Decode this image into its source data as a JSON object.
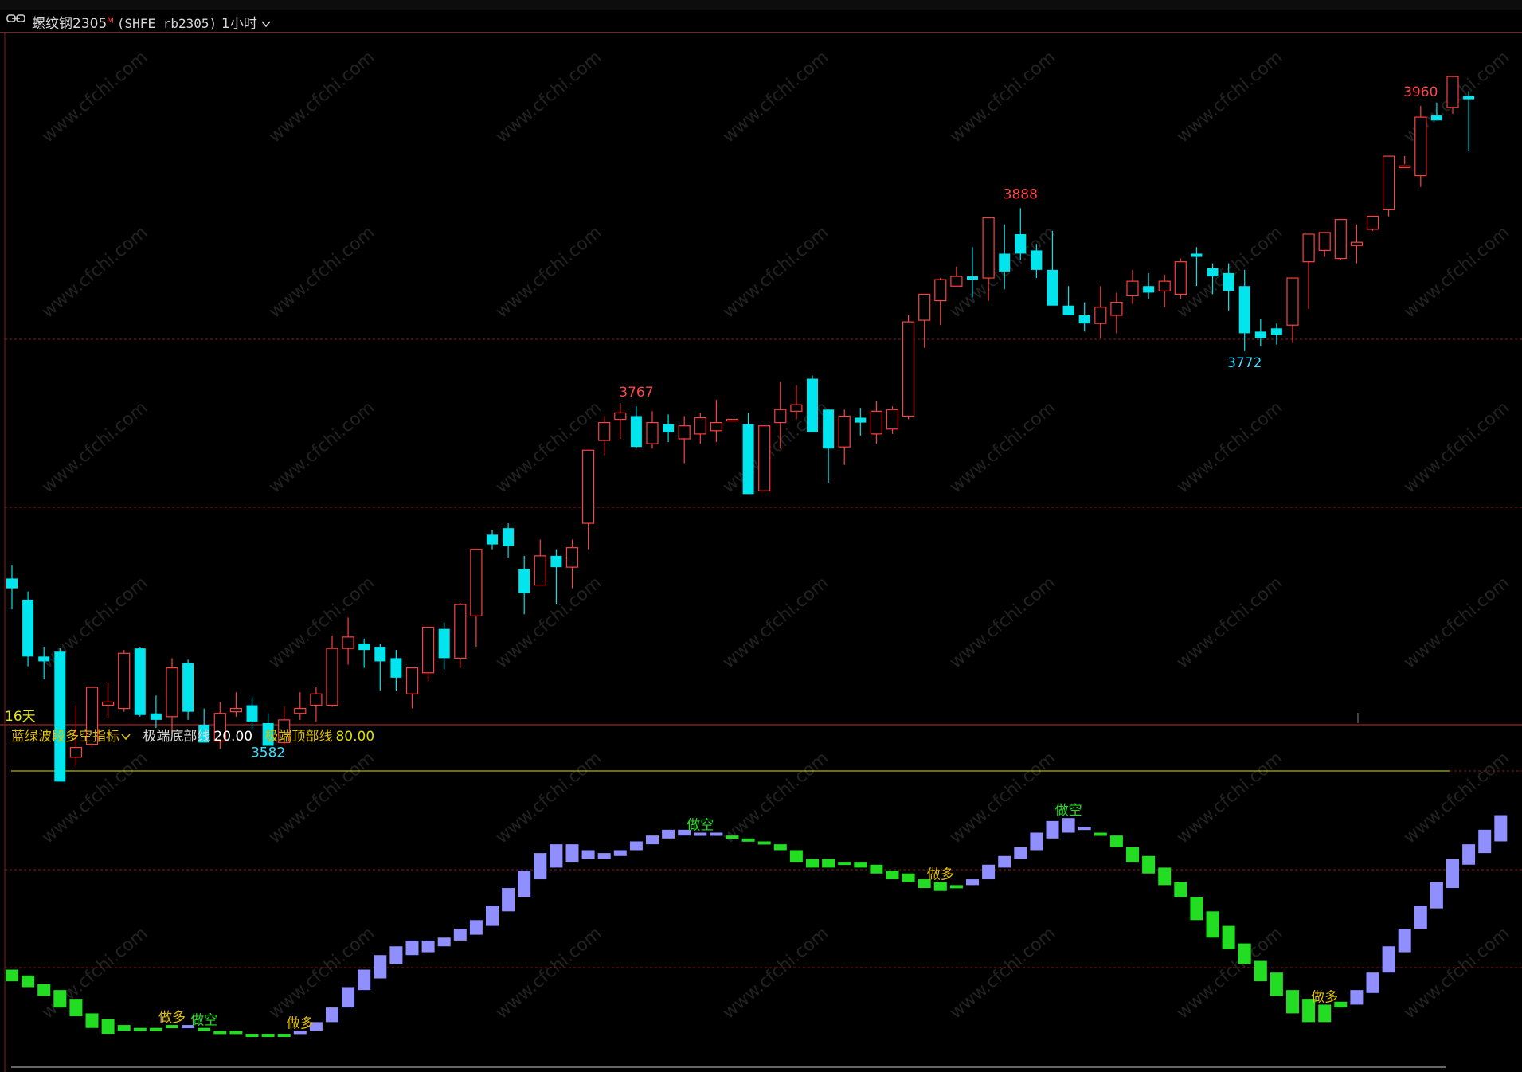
{
  "header": {
    "instrument_name": "螺纹钢2305",
    "main_contract_mark": "M",
    "code": "(SHFE rb2305)",
    "period": "1小时",
    "colors": {
      "bar": "#000000",
      "divider": "#7a1f1f"
    }
  },
  "main_panel": {
    "days_label": "16天",
    "watermark": "www.cfchi.com",
    "extreme_labels": [
      {
        "value": "3960",
        "bar": 88,
        "kind": "high"
      },
      {
        "value": "3888",
        "bar": 63,
        "kind": "high"
      },
      {
        "value": "3767",
        "bar": 39,
        "kind": "high"
      },
      {
        "value": "3772",
        "bar": 77,
        "kind": "low"
      },
      {
        "value": "3582",
        "bar": 16,
        "kind": "low"
      }
    ]
  },
  "indicator": {
    "name": "蓝绿波段多空指标",
    "bottom_line_label": "极端底部线",
    "bottom_line_value": "20.00",
    "top_line_label": "极端顶部线",
    "top_line_value": "80.00",
    "signals": [
      {
        "text": "做多",
        "bar": 10,
        "kind": "long"
      },
      {
        "text": "做空",
        "bar": 12,
        "kind": "short"
      },
      {
        "text": "做多",
        "bar": 18,
        "kind": "long"
      },
      {
        "text": "做空",
        "bar": 43,
        "kind": "short"
      },
      {
        "text": "做多",
        "bar": 58,
        "kind": "long"
      },
      {
        "text": "做空",
        "bar": 66,
        "kind": "short"
      },
      {
        "text": "做多",
        "bar": 82,
        "kind": "long"
      }
    ]
  },
  "colors": {
    "up": "#ff4040",
    "down": "#00e5ee",
    "long_bar": "#8f8fff",
    "short_bar": "#22dd22",
    "grid": "#8a1a1a",
    "extreme_line": "#e0e000",
    "title_yellow": "#e0c000",
    "label_red": "#ff4545",
    "label_cyan": "#40e0ff"
  },
  "chart_data": [
    {
      "type": "candlestick",
      "title": "",
      "ylim": [
        3570,
        3972
      ],
      "candles": [
        [
          3660,
          3668,
          3641,
          3654
        ],
        [
          3647,
          3652,
          3606,
          3612
        ],
        [
          3612,
          3618,
          3598,
          3609
        ],
        [
          3615,
          3617,
          3539,
          3535
        ],
        [
          3550,
          3582,
          3545,
          3556
        ],
        [
          3558,
          3585,
          3556,
          3593
        ],
        [
          3582,
          3596,
          3574,
          3584
        ],
        [
          3580,
          3616,
          3578,
          3614
        ],
        [
          3617,
          3618,
          3575,
          3576
        ],
        [
          3577,
          3588,
          3568,
          3573
        ],
        [
          3575,
          3611,
          3564,
          3605
        ],
        [
          3608,
          3610,
          3573,
          3578
        ],
        [
          3570,
          3580,
          3564,
          3559
        ],
        [
          3560,
          3584,
          3555,
          3577
        ],
        [
          3578,
          3590,
          3575,
          3580
        ],
        [
          3582,
          3587,
          3567,
          3572
        ],
        [
          3571,
          3577,
          3560,
          3557
        ],
        [
          3559,
          3581,
          3557,
          3573
        ],
        [
          3577,
          3590,
          3573,
          3580
        ],
        [
          3582,
          3593,
          3572,
          3589
        ],
        [
          3582,
          3625,
          3581,
          3617
        ],
        [
          3617,
          3636,
          3607,
          3624
        ],
        [
          3620,
          3623,
          3605,
          3616
        ],
        [
          3618,
          3620,
          3591,
          3609
        ],
        [
          3611,
          3616,
          3591,
          3599
        ],
        [
          3589,
          3604,
          3580,
          3605
        ],
        [
          3602,
          3621,
          3597,
          3630
        ],
        [
          3629,
          3633,
          3604,
          3611
        ],
        [
          3611,
          3645,
          3605,
          3644
        ],
        [
          3637,
          3664,
          3618,
          3678
        ],
        [
          3687,
          3690,
          3678,
          3681
        ],
        [
          3691,
          3694,
          3673,
          3680
        ],
        [
          3666,
          3674,
          3638,
          3651
        ],
        [
          3656,
          3684,
          3656,
          3674
        ],
        [
          3674,
          3678,
          3644,
          3667
        ],
        [
          3667,
          3684,
          3654,
          3679
        ],
        [
          3694,
          3727,
          3678,
          3739
        ],
        [
          3745,
          3760,
          3736,
          3756
        ],
        [
          3758,
          3768,
          3746,
          3762
        ],
        [
          3760,
          3766,
          3740,
          3741
        ],
        [
          3743,
          3763,
          3740,
          3756
        ],
        [
          3755,
          3761,
          3744,
          3750
        ],
        [
          3746,
          3760,
          3731,
          3754
        ],
        [
          3749,
          3762,
          3743,
          3759
        ],
        [
          3751,
          3770,
          3744,
          3756
        ],
        [
          3757,
          3758,
          3758,
          3758
        ],
        [
          3755,
          3762,
          3712,
          3712
        ],
        [
          3714,
          3724,
          3714,
          3754
        ],
        [
          3756,
          3781,
          3740,
          3764
        ],
        [
          3763,
          3779,
          3758,
          3767
        ],
        [
          3783,
          3785,
          3750,
          3750
        ],
        [
          3764,
          3764,
          3719,
          3740
        ],
        [
          3741,
          3764,
          3730,
          3760
        ],
        [
          3759,
          3765,
          3748,
          3756
        ],
        [
          3749,
          3769,
          3743,
          3763
        ],
        [
          3752,
          3766,
          3749,
          3764
        ],
        [
          3760,
          3822,
          3758,
          3818
        ],
        [
          3819,
          3826,
          3802,
          3835
        ],
        [
          3831,
          3845,
          3816,
          3844
        ],
        [
          3840,
          3852,
          3840,
          3846
        ],
        [
          3846,
          3864,
          3833,
          3844
        ],
        [
          3845,
          3853,
          3831,
          3882
        ],
        [
          3860,
          3878,
          3838,
          3849
        ],
        [
          3872,
          3888,
          3856,
          3860
        ],
        [
          3862,
          3866,
          3845,
          3850
        ],
        [
          3850,
          3874,
          3829,
          3828
        ],
        [
          3828,
          3840,
          3824,
          3822
        ],
        [
          3822,
          3830,
          3812,
          3817
        ],
        [
          3817,
          3840,
          3808,
          3827
        ],
        [
          3822,
          3836,
          3811,
          3830
        ],
        [
          3834,
          3850,
          3829,
          3843
        ],
        [
          3840,
          3848,
          3832,
          3836
        ],
        [
          3837,
          3847,
          3827,
          3843
        ],
        [
          3835,
          3857,
          3832,
          3855
        ],
        [
          3860,
          3864,
          3840,
          3858
        ],
        [
          3851,
          3854,
          3835,
          3846
        ],
        [
          3848,
          3854,
          3825,
          3837
        ],
        [
          3840,
          3850,
          3800,
          3811
        ],
        [
          3812,
          3820,
          3803,
          3808
        ],
        [
          3814,
          3817,
          3804,
          3810
        ],
        [
          3816,
          3842,
          3805,
          3845
        ],
        [
          3855,
          3868,
          3826,
          3872
        ],
        [
          3862,
          3870,
          3858,
          3873
        ],
        [
          3857,
          3877,
          3856,
          3881
        ],
        [
          3865,
          3878,
          3854,
          3867
        ],
        [
          3875,
          3881,
          3874,
          3883
        ],
        [
          3887,
          3918,
          3883,
          3920
        ],
        [
          3913,
          3920,
          3915,
          3914
        ],
        [
          3908,
          3951,
          3901,
          3944
        ],
        [
          3945,
          3953,
          3942,
          3942
        ],
        [
          3950,
          3960,
          3946,
          3969
        ],
        [
          3957,
          3960,
          3923,
          3955
        ]
      ]
    },
    {
      "type": "bar",
      "title": "蓝绿波段多空指标",
      "ylim": [
        0,
        100
      ],
      "reference_lines": [
        20,
        80
      ],
      "bars": [
        [
          24,
          28,
          "short"
        ],
        [
          22,
          26,
          "short"
        ],
        [
          19,
          23,
          "short"
        ],
        [
          15,
          21,
          "short"
        ],
        [
          12,
          18,
          "short"
        ],
        [
          8,
          13,
          "short"
        ],
        [
          6,
          11,
          "short"
        ],
        [
          7,
          9,
          "short"
        ],
        [
          7,
          8,
          "short"
        ],
        [
          7,
          8,
          "short"
        ],
        [
          8,
          9,
          "short"
        ],
        [
          8,
          9,
          "long"
        ],
        [
          7,
          8,
          "short"
        ],
        [
          6,
          7,
          "short"
        ],
        [
          6,
          7,
          "short"
        ],
        [
          5,
          6,
          "short"
        ],
        [
          5,
          6,
          "short"
        ],
        [
          5,
          6,
          "short"
        ],
        [
          6,
          7,
          "long"
        ],
        [
          7,
          10,
          "long"
        ],
        [
          10,
          15,
          "long"
        ],
        [
          15,
          22,
          "long"
        ],
        [
          21,
          28,
          "long"
        ],
        [
          25,
          33,
          "long"
        ],
        [
          30,
          36,
          "long"
        ],
        [
          33,
          38,
          "long"
        ],
        [
          34,
          38,
          "long"
        ],
        [
          36,
          39,
          "long"
        ],
        [
          38,
          42,
          "long"
        ],
        [
          40,
          45,
          "long"
        ],
        [
          43,
          50,
          "long"
        ],
        [
          48,
          56,
          "long"
        ],
        [
          53,
          62,
          "long"
        ],
        [
          59,
          68,
          "long"
        ],
        [
          63,
          71,
          "long"
        ],
        [
          65,
          71,
          "long"
        ],
        [
          66,
          69,
          "long"
        ],
        [
          66,
          68,
          "long"
        ],
        [
          67,
          69,
          "long"
        ],
        [
          69,
          72,
          "long"
        ],
        [
          71,
          74,
          "long"
        ],
        [
          73,
          76,
          "long"
        ],
        [
          74,
          76,
          "long"
        ],
        [
          74,
          75,
          "long"
        ],
        [
          74,
          75,
          "long"
        ],
        [
          73,
          74,
          "short"
        ],
        [
          72,
          73,
          "short"
        ],
        [
          71,
          72,
          "short"
        ],
        [
          69,
          71,
          "short"
        ],
        [
          65,
          69,
          "short"
        ],
        [
          63,
          66,
          "short"
        ],
        [
          63,
          66,
          "short"
        ],
        [
          64,
          65,
          "short"
        ],
        [
          63,
          65,
          "short"
        ],
        [
          61,
          64,
          "short"
        ],
        [
          59,
          62,
          "short"
        ],
        [
          58,
          61,
          "short"
        ],
        [
          56,
          59,
          "short"
        ],
        [
          55,
          58,
          "short"
        ],
        [
          56,
          57,
          "short"
        ],
        [
          57,
          59,
          "long"
        ],
        [
          59,
          64,
          "long"
        ],
        [
          63,
          67,
          "long"
        ],
        [
          66,
          70,
          "long"
        ],
        [
          69,
          75,
          "long"
        ],
        [
          73,
          79,
          "long"
        ],
        [
          75,
          80,
          "long"
        ],
        [
          76,
          77,
          "long"
        ],
        [
          74,
          75,
          "short"
        ],
        [
          70,
          74,
          "short"
        ],
        [
          65,
          70,
          "short"
        ],
        [
          61,
          67,
          "short"
        ],
        [
          57,
          63,
          "short"
        ],
        [
          53,
          58,
          "short"
        ],
        [
          45,
          53,
          "short"
        ],
        [
          39,
          48,
          "short"
        ],
        [
          35,
          43,
          "short"
        ],
        [
          30,
          37,
          "short"
        ],
        [
          24,
          31,
          "short"
        ],
        [
          19,
          27,
          "short"
        ],
        [
          13,
          21,
          "short"
        ],
        [
          10,
          18,
          "short"
        ],
        [
          10,
          16,
          "short"
        ],
        [
          15,
          17,
          "short"
        ],
        [
          16,
          21,
          "long"
        ],
        [
          20,
          27,
          "long"
        ],
        [
          27,
          36,
          "long"
        ],
        [
          34,
          42,
          "long"
        ],
        [
          42,
          50,
          "long"
        ],
        [
          49,
          58,
          "long"
        ],
        [
          56,
          66,
          "long"
        ],
        [
          64,
          71,
          "long"
        ],
        [
          68,
          76,
          "long"
        ],
        [
          72,
          81,
          "long"
        ]
      ]
    }
  ]
}
